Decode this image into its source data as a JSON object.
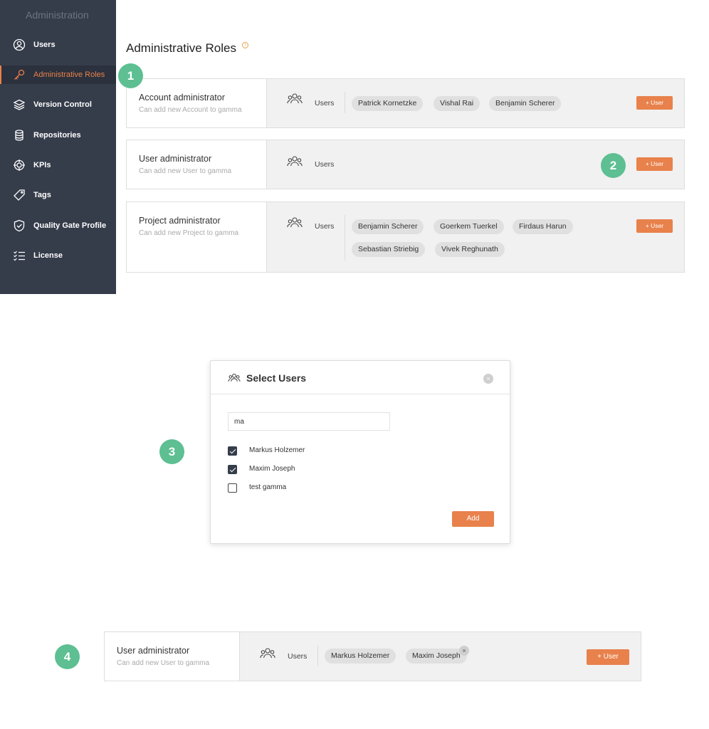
{
  "sidebar": {
    "title": "Administration",
    "items": [
      {
        "label": "Users",
        "icon": "user-circle-icon"
      },
      {
        "label": "Administrative Roles",
        "icon": "key-icon",
        "active": true
      },
      {
        "label": "Version Control",
        "icon": "layers-icon"
      },
      {
        "label": "Repositories",
        "icon": "database-icon"
      },
      {
        "label": "KPIs",
        "icon": "target-icon"
      },
      {
        "label": "Tags",
        "icon": "tag-icon"
      },
      {
        "label": "Quality Gate Profile",
        "icon": "shield-check-icon"
      },
      {
        "label": "License",
        "icon": "checklist-icon"
      }
    ]
  },
  "page": {
    "title": "Administrative Roles"
  },
  "roles": [
    {
      "name": "Account administrator",
      "description": "Can add new Account to gamma",
      "users_label": "Users",
      "users": [
        "Patrick Kornetzke",
        "Vishal Rai",
        "Benjamin Scherer"
      ],
      "add_label": "+ User"
    },
    {
      "name": "User administrator",
      "description": "Can add new User to gamma",
      "users_label": "Users",
      "users": [],
      "add_label": "+ User"
    },
    {
      "name": "Project administrator",
      "description": "Can add new Project to gamma",
      "users_label": "Users",
      "users": [
        "Benjamin Scherer",
        "Goerkem Tuerkel",
        "Firdaus Harun",
        "Sebastian Striebig",
        "Vivek Reghunath"
      ],
      "add_label": "+ User"
    }
  ],
  "steps": [
    "1",
    "2",
    "3",
    "4"
  ],
  "modal": {
    "title": "Select Users",
    "close_glyph": "×",
    "search_value": "ma",
    "options": [
      {
        "label": "Markus Holzemer",
        "checked": true
      },
      {
        "label": "Maxim Joseph",
        "checked": true
      },
      {
        "label": "test gamma",
        "checked": false
      }
    ],
    "add_label": "Add"
  },
  "result": {
    "name": "User administrator",
    "description": "Can add new User to gamma",
    "users_label": "Users",
    "users": [
      "Markus Holzemer",
      "Maxim Joseph"
    ],
    "remove_glyph": "×",
    "add_label": "+ User"
  },
  "colors": {
    "sidebar_bg": "#353c4a",
    "accent": "#e8814b",
    "step_badge": "#5dbf92"
  }
}
